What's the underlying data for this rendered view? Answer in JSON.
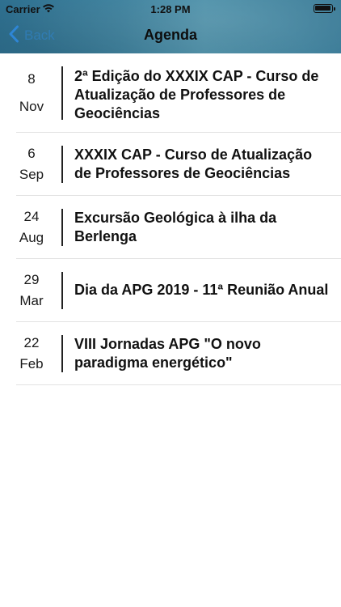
{
  "status_bar": {
    "carrier": "Carrier",
    "time": "1:28 PM"
  },
  "nav": {
    "back_label": "Back",
    "title": "Agenda"
  },
  "events": [
    {
      "day": "8",
      "month": "Nov",
      "title": "2ª Edição do XXXIX CAP - Curso de Atualização de Professores de Geociências"
    },
    {
      "day": "6",
      "month": "Sep",
      "title": "XXXIX CAP - Curso de Atualização de Professores de Geociências"
    },
    {
      "day": "24",
      "month": "Aug",
      "title": "Excursão Geológica à ilha da Berlenga"
    },
    {
      "day": "29",
      "month": "Mar",
      "title": "Dia da APG 2019 - 11ª Reunião Anual"
    },
    {
      "day": "22",
      "month": "Feb",
      "title": "VIII Jornadas APG \"O novo paradigma energético\""
    }
  ]
}
